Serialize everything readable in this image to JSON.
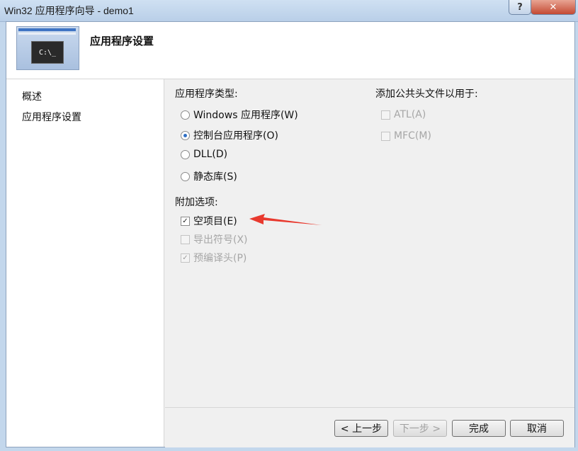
{
  "window": {
    "title": "Win32 应用程序向导 - demo1",
    "help_label": "?",
    "close_label": "✕"
  },
  "header": {
    "title": "应用程序设置",
    "thumbnail_text": "C:\\_"
  },
  "sidebar": {
    "items": [
      {
        "label": "概述"
      },
      {
        "label": "应用程序设置"
      }
    ]
  },
  "app_type": {
    "heading": "应用程序类型:",
    "options": [
      {
        "label": "Windows 应用程序(W)",
        "selected": false
      },
      {
        "label": "控制台应用程序(O)",
        "selected": true
      },
      {
        "label": "DLL(D)",
        "selected": false
      },
      {
        "label": "静态库(S)",
        "selected": false
      }
    ]
  },
  "extra_options": {
    "heading": "附加选项:",
    "options": [
      {
        "label": "空项目(E)",
        "checked": true,
        "enabled": true
      },
      {
        "label": "导出符号(X)",
        "checked": false,
        "enabled": false
      },
      {
        "label": "预编译头(P)",
        "checked": true,
        "enabled": false
      }
    ]
  },
  "common_headers": {
    "heading": "添加公共头文件以用于:",
    "options": [
      {
        "label": "ATL(A)",
        "checked": false,
        "enabled": false
      },
      {
        "label": "MFC(M)",
        "checked": false,
        "enabled": false
      }
    ]
  },
  "buttons": {
    "back": "< 上一步",
    "next": "下一步 >",
    "finish": "完成",
    "cancel": "取消"
  },
  "annotation": {
    "color": "#e8392e"
  }
}
